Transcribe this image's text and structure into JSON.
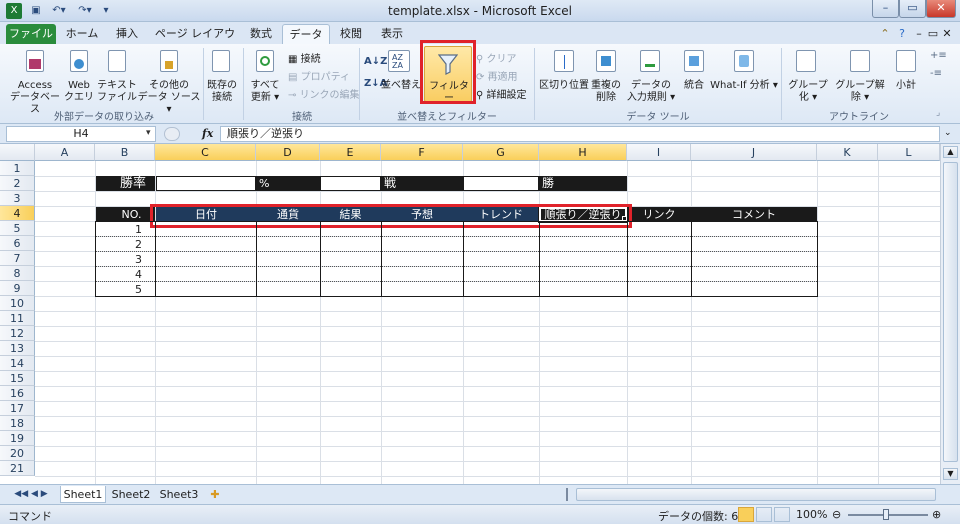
{
  "window": {
    "title": "template.xlsx - Microsoft Excel"
  },
  "tabs": [
    "ファイル",
    "ホーム",
    "挿入",
    "ページ レイアウト",
    "数式",
    "データ",
    "校閲",
    "表示"
  ],
  "ribbon": {
    "ext_data": {
      "items": [
        {
          "line1": "Access",
          "line2": "データベース"
        },
        {
          "line1": "Web",
          "line2": "クエリ"
        },
        {
          "line1": "テキスト",
          "line2": "ファイル"
        },
        {
          "line1": "その他の",
          "line2": "データ ソース ▾"
        }
      ],
      "existing": {
        "line1": "既存の",
        "line2": "接続"
      },
      "label": "外部データの取り込み"
    },
    "connections": {
      "refresh": {
        "line1": "すべて",
        "line2": "更新 ▾"
      },
      "connect": "接続",
      "properties": "プロパティ",
      "edit_links": "リンクの編集",
      "label": "接続"
    },
    "sort_filter": {
      "sort": "並べ替え",
      "filter": "フィルター",
      "clear": "クリア",
      "reapply": "再適用",
      "advanced": "詳細設定",
      "label": "並べ替えとフィルター"
    },
    "data_tools": {
      "text_to_columns": "区切り位置",
      "remove_dup": {
        "line1": "重複の",
        "line2": "削除"
      },
      "validation": {
        "line1": "データの",
        "line2": "入力規則 ▾"
      },
      "consolidate": "統合",
      "what_if": "What-If 分析 ▾",
      "label": "データ ツール"
    },
    "outline": {
      "group": "グループ化 ▾",
      "ungroup": "グループ解除 ▾",
      "subtotal": "小計",
      "label": "アウトライン"
    }
  },
  "formula_bar": {
    "name_box": "H4",
    "fx": "fx",
    "content": "順張り／逆張り"
  },
  "columns": [
    "A",
    "B",
    "C",
    "D",
    "E",
    "F",
    "G",
    "H",
    "I",
    "J",
    "K",
    "L"
  ],
  "rows": [
    "1",
    "2",
    "3",
    "4",
    "5",
    "6",
    "7",
    "8",
    "9",
    "10",
    "11",
    "12",
    "13",
    "14",
    "15",
    "16",
    "17",
    "18",
    "19",
    "20",
    "21"
  ],
  "cells": {
    "win_rate": "勝率",
    "percent": "%",
    "battles": "戦",
    "wins": "勝",
    "headers": [
      "NO.",
      "日付",
      "通貨",
      "結果",
      "予想",
      "トレンド",
      "順張り／逆張り",
      "リンク",
      "コメント"
    ],
    "numbers": [
      "1",
      "2",
      "3",
      "4",
      "5"
    ]
  },
  "sheets": [
    "Sheet1",
    "Sheet2",
    "Sheet3"
  ],
  "status": {
    "mode": "コマンド",
    "count": "データの個数: 6",
    "zoom": "100%"
  }
}
